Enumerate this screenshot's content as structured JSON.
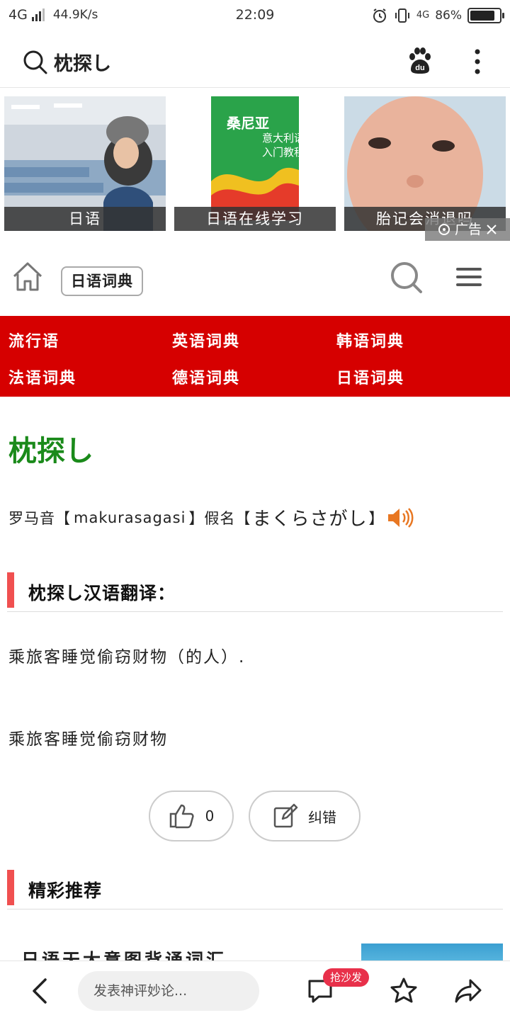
{
  "status_bar": {
    "network": "4G",
    "speed": "44.9K/s",
    "time": "22:09",
    "net2": "4G",
    "battery_pct": "86%",
    "battery_level": 0.86
  },
  "browser": {
    "query": "枕探し"
  },
  "ads": {
    "items": [
      {
        "caption": "日语"
      },
      {
        "caption": "日语在线学习"
      },
      {
        "caption": "胎记会消退吗"
      }
    ],
    "book_title_1": "桑尼亚",
    "book_title_2": "意大利语",
    "book_title_3": "入门教程",
    "ad_label": "广告"
  },
  "site_header": {
    "dict_label": "日语词典"
  },
  "nav": {
    "items": [
      "流行语",
      "英语词典",
      "韩语词典",
      "法语词典",
      "德语词典",
      "日语词典"
    ]
  },
  "entry": {
    "word": "枕探し",
    "romaji_label": "罗马音【",
    "romaji": "makurasagasi",
    "kana_label": "】假名【",
    "kana": "まくらさがし",
    "kana_close": "】",
    "section_translation": "枕探し汉语翻译：",
    "meaning_1": "乘旅客睡觉偷窃财物（的人）.",
    "meaning_2": "乘旅客睡觉偷窃财物"
  },
  "actions": {
    "like_count": "0",
    "correct_label": "纠错"
  },
  "recommend": {
    "section_title": "精彩推荐",
    "first_item": "日语天大意图背诵词汇"
  },
  "bottom_bar": {
    "comment_placeholder": "发表神评妙论...",
    "sofa_badge": "抢沙发"
  },
  "colors": {
    "nav_red": "#d60000",
    "word_green": "#1a8a1a",
    "section_accent": "#f05050",
    "badge_red": "#e8304a"
  },
  "icons": [
    "search-icon",
    "baidu-paw-icon",
    "more-icon",
    "home-icon",
    "site-search-icon",
    "menu-icon",
    "speaker-icon",
    "thumbs-up-icon",
    "edit-icon",
    "back-icon",
    "comment-icon",
    "star-icon",
    "share-icon",
    "close-icon"
  ]
}
